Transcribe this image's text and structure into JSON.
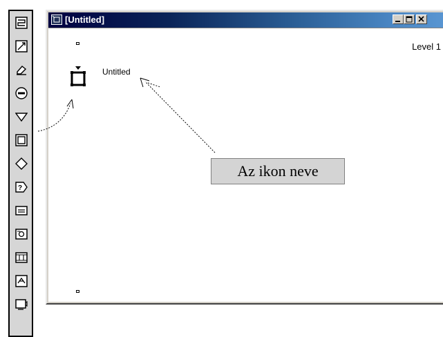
{
  "window": {
    "title": "[Untitled]",
    "level_label": "Level 1",
    "icon_name_label": "Untitled",
    "buttons": [
      "minimize",
      "maximize",
      "close"
    ]
  },
  "callout": {
    "text": "Az ikon neve"
  },
  "palette": {
    "tools": [
      {
        "name": "display-tool-icon"
      },
      {
        "name": "animation-tool-icon"
      },
      {
        "name": "erase-tool-icon"
      },
      {
        "name": "wait-tool-icon"
      },
      {
        "name": "navigate-tool-icon"
      },
      {
        "name": "framework-tool-icon"
      },
      {
        "name": "decision-tool-icon"
      },
      {
        "name": "interaction-tool-icon"
      },
      {
        "name": "calculation-tool-icon"
      },
      {
        "name": "map-tool-icon"
      },
      {
        "name": "movie-tool-icon"
      },
      {
        "name": "sound-tool-icon"
      },
      {
        "name": "video-tool-icon"
      }
    ]
  }
}
